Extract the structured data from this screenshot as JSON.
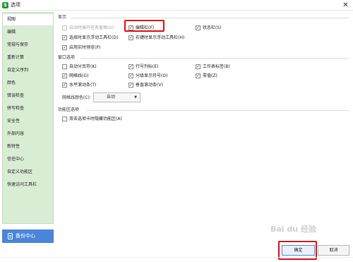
{
  "window": {
    "title": "选项",
    "app_icon_letter": "S",
    "close_glyph": "✕"
  },
  "sidebar": {
    "items": [
      {
        "label": "视图",
        "active": true
      },
      {
        "label": "编辑"
      },
      {
        "label": "常规与保存"
      },
      {
        "label": "重新计算"
      },
      {
        "label": "自定义序列"
      },
      {
        "label": "颜色"
      },
      {
        "label": "错误检查"
      },
      {
        "label": "拼写检查"
      },
      {
        "label": "安全性"
      },
      {
        "label": "外部内容"
      },
      {
        "label": "新特性"
      },
      {
        "label": "信任中心"
      },
      {
        "label": "自定义功能区"
      },
      {
        "label": "快速访问工具栏"
      }
    ],
    "backup_label": "备份中心"
  },
  "display": {
    "title": "显示",
    "options": [
      {
        "label": "启动时展开任务窗格(U)",
        "checked": false,
        "disabled": true
      },
      {
        "label": "编辑栏(F)",
        "checked": true
      },
      {
        "label": "状态栏(S)",
        "checked": true
      },
      {
        "label": "选择时显示浮动工具栏(D)",
        "checked": true
      },
      {
        "label": "右键时显示浮动工具栏(H)",
        "checked": true
      },
      {
        "label": "启用实时预览(P)",
        "checked": true
      }
    ]
  },
  "window_options": {
    "title": "窗口选项",
    "options": [
      {
        "label": "自动分页符(K)",
        "checked": false
      },
      {
        "label": "行号列标(E)",
        "checked": true
      },
      {
        "label": "工作表标签(B)",
        "checked": true
      },
      {
        "label": "网格线(G)",
        "checked": true
      },
      {
        "label": "分级显示符号(O)",
        "checked": true
      },
      {
        "label": "零值(Z)",
        "checked": true
      },
      {
        "label": "水平滚动条(T)",
        "checked": true
      },
      {
        "label": "垂直滚动条(V)",
        "checked": true
      }
    ],
    "gridline_color_label": "网格线颜色(C):",
    "gridline_color_value": "自动",
    "dropdown_arrow": "▼"
  },
  "ribbon": {
    "title": "功能区选项",
    "options": [
      {
        "label": "双击选项卡时隐藏功能区(A)",
        "checked": false
      }
    ]
  },
  "footer": {
    "ok_label": "确定",
    "cancel_label": "取消"
  },
  "watermark": "Bai du 经验",
  "colors": {
    "sidebar_bg": "#d9ecd4",
    "accent": "#4a86d8",
    "highlight": "#e0161a",
    "app_icon": "#2f9e44"
  }
}
